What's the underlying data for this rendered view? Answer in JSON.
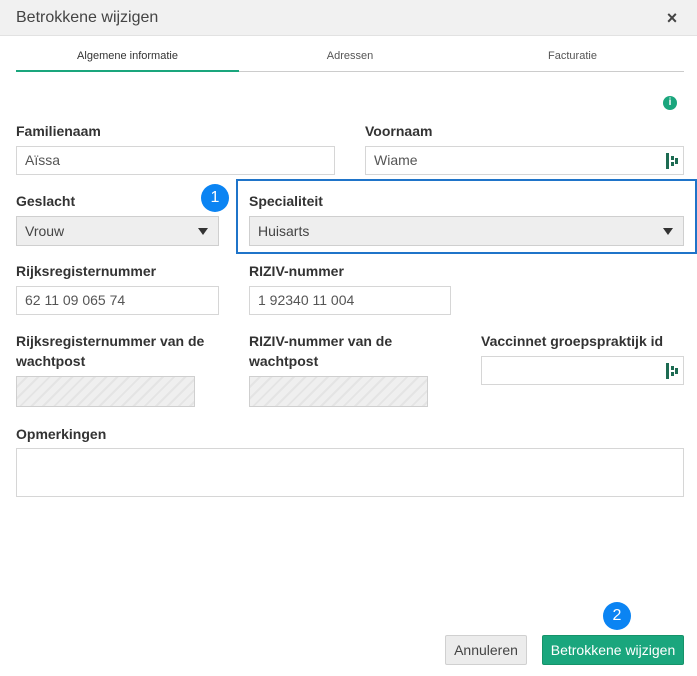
{
  "dialog": {
    "title": "Betrokkene wijzigen"
  },
  "tabs": [
    {
      "label": "Algemene informatie"
    },
    {
      "label": "Adressen"
    },
    {
      "label": "Facturatie"
    }
  ],
  "form": {
    "familienaam": {
      "label": "Familienaam",
      "value": "Aïssa"
    },
    "voornaam": {
      "label": "Voornaam",
      "value": "Wiame"
    },
    "geslacht": {
      "label": "Geslacht",
      "value": "Vrouw"
    },
    "specialiteit": {
      "label": "Specialiteit",
      "value": "Huisarts"
    },
    "rijksregisternummer": {
      "label": "Rijksregisternummer",
      "value": "62 11 09 065 74"
    },
    "riziv": {
      "label": "RIZIV-nummer",
      "value": "1 92340 11 004"
    },
    "rijksregister_wachtpost": {
      "label_line1": "Rijksregisternummer van de",
      "label_line2": "wachtpost"
    },
    "riziv_wachtpost": {
      "label_line1": "RIZIV-nummer van de",
      "label_line2": "wachtpost"
    },
    "vaccinnet": {
      "label": "Vaccinnet groepspraktijk id",
      "value": ""
    },
    "opmerkingen": {
      "label": "Opmerkingen",
      "value": ""
    }
  },
  "annotations": {
    "badge1": "1",
    "badge2": "2"
  },
  "buttons": {
    "cancel": "Annuleren",
    "save": "Betrokkene wijzigen"
  },
  "icons": {
    "info": "info-icon",
    "close": "close-icon",
    "picker": "picker-icon"
  },
  "colors": {
    "accent": "#1aa67d",
    "highlight": "#1f74c9",
    "badge": "#0b84f3"
  }
}
